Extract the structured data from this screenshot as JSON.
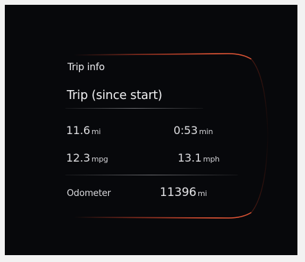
{
  "panel": {
    "title": "Trip info",
    "subtitle": "Trip (since start)"
  },
  "stats": {
    "distance": {
      "value": "11.6",
      "unit": "mi"
    },
    "time": {
      "value": "0:53",
      "unit": "min"
    },
    "economy": {
      "value": "12.3",
      "unit": "mpg"
    },
    "speed": {
      "value": "13.1",
      "unit": "mph"
    }
  },
  "odometer": {
    "label": "Odometer",
    "value": "11396",
    "unit": "mi"
  },
  "colors": {
    "accent_arc": "#e0452a",
    "background": "#07080b",
    "text": "#e9e9ec"
  }
}
